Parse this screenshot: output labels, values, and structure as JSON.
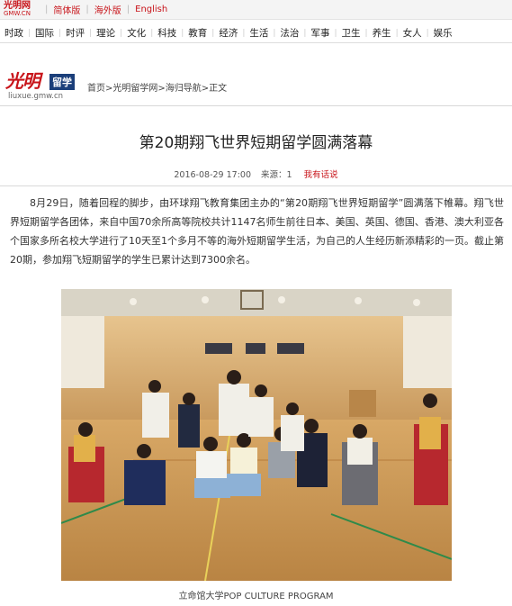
{
  "topbar": {
    "logo_text": "光明网",
    "logo_sub": "GMW.CN",
    "links": [
      "简体版",
      "海外版",
      "English"
    ]
  },
  "nav": {
    "items": [
      "时政",
      "国际",
      "时评",
      "理论",
      "文化",
      "科技",
      "教育",
      "经济",
      "生活",
      "法治",
      "军事",
      "卫生",
      "养生",
      "女人",
      "娱乐"
    ]
  },
  "header": {
    "logo_mark": "光明",
    "logo_badge": "留学",
    "logo_url": "liuxue.gmw.cn",
    "breadcrumb": "首页>光明留学网>海归导航>正文"
  },
  "article": {
    "title": "第20期翔飞世界短期留学圆满落幕",
    "date": "2016-08-29 17:00",
    "source": "来源：1",
    "comment_link": "我有话说",
    "body": "8月29日，随着回程的脚步，由环球翔飞教育集团主办的“第20期翔飞世界短期留学”圆满落下帷幕。翔飞世界短期留学各团体，来自中国70余所高等院校共计1147名师生前往日本、美国、英国、德国、香港、澳大利亚各个国家多所名校大学进行了10天至1个多月不等的海外短期留学生活，为自己的人生经历新添精彩的一页。截止第20期，参加翔飞短期留学的学生已累计达到7300余名。",
    "caption": "立命馆大学POP CULTURE PROGRAM"
  },
  "colors": {
    "brand_red": "#c8141a",
    "badge_blue": "#1b3f7a"
  }
}
